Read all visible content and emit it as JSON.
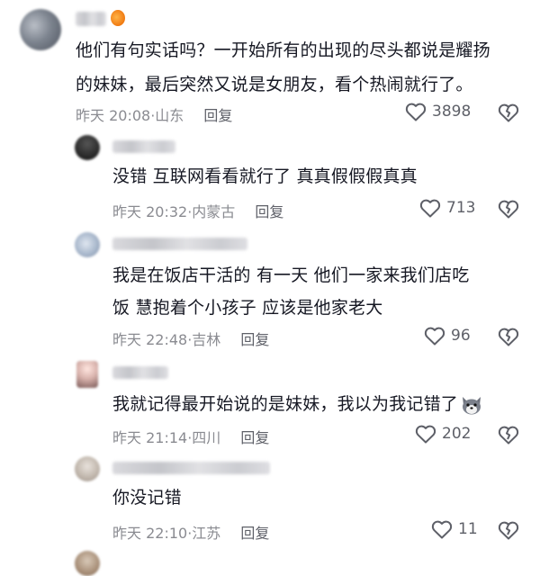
{
  "comments": [
    {
      "text_lines": [
        "他们有句实话吗？一开始所有的出现的尽头都说是耀扬",
        "的妹妹，最后突然又说是女朋友，看个热闹就行了。"
      ],
      "time": "昨天 20:08",
      "location": "山东",
      "reply_label": "回复",
      "likes": "3898"
    },
    {
      "text_lines": [
        "没错 互联网看看就行了 真真假假假真真"
      ],
      "time": "昨天 20:32",
      "location": "内蒙古",
      "reply_label": "回复",
      "likes": "713"
    },
    {
      "text_lines": [
        "我是在饭店干活的   有一天   他们一家来我们店吃",
        "饭   慧抱着个小孩子    应该是他家老大"
      ],
      "time": "昨天 22:48",
      "location": "吉林",
      "reply_label": "回复",
      "likes": "96"
    },
    {
      "text_lines": [
        "我就记得最开始说的是妹妹，我以为我记错了"
      ],
      "time": "昨天 21:14",
      "location": "四川",
      "reply_label": "回复",
      "likes": "202"
    },
    {
      "text_lines": [
        "你没记错"
      ],
      "time": "昨天 22:10",
      "location": "江苏",
      "reply_label": "回复",
      "likes": "11"
    }
  ],
  "separator": "·",
  "colors": {
    "text": "#161823",
    "meta": "#8a8b91",
    "icon": "#5e6068"
  },
  "icons": {
    "like": "heart-outline-icon",
    "dislike": "broken-heart-icon",
    "emoji": "husky-dog-emoji-icon"
  }
}
